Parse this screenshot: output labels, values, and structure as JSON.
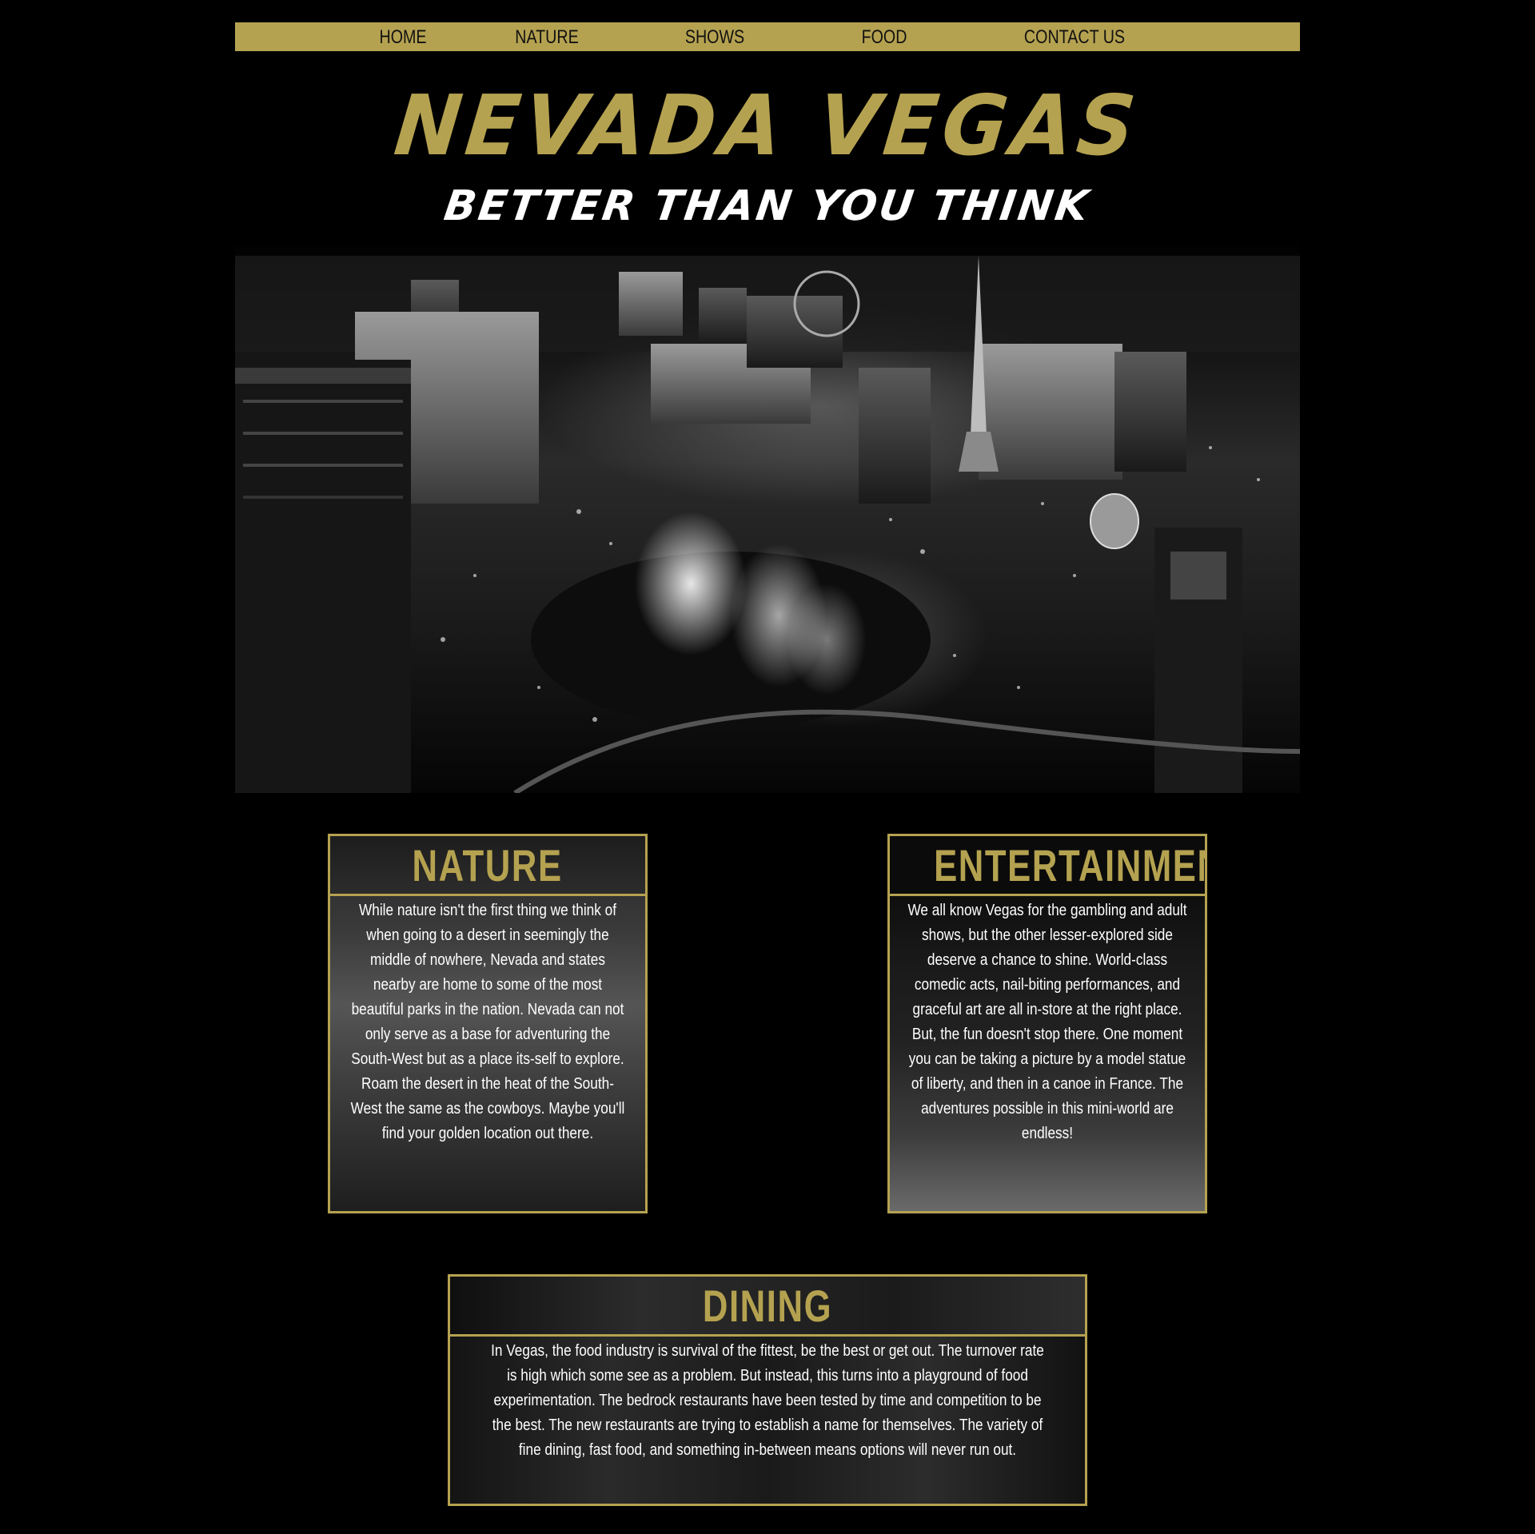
{
  "nav": {
    "items": [
      {
        "label": "HOME"
      },
      {
        "label": "NATURE"
      },
      {
        "label": "SHOWS"
      },
      {
        "label": "FOOD"
      },
      {
        "label": "CONTACT US"
      }
    ]
  },
  "header": {
    "title": "NEVADA VEGAS",
    "subtitle": "BETTER THAN YOU THINK"
  },
  "sections": {
    "nature": {
      "title": "NATURE",
      "text": "While nature isn't the first thing we think of when going to a desert in seemingly the middle of nowhere, Nevada and states nearby are home to some of the most beautiful parks in the nation. Nevada can not only serve as a base for adventuring the South-West but as a place its-self to explore. Roam the desert in the heat of the South-West the same as the cowboys. Maybe you'll find your golden location out there."
    },
    "entertainment": {
      "title": "ENTERTAINMENT",
      "text": "We all know Vegas for the gambling and adult shows, but the other lesser-explored side deserve a chance to shine. World-class comedic acts, nail-biting performances, and graceful art are all in-store at the right place. But, the fun doesn't stop there. One moment you can be taking a picture by a model statue of liberty, and then in a canoe in France. The adventures possible in this mini-world are endless!"
    },
    "dining": {
      "title": "DINING",
      "text": "In Vegas, the food industry is survival of the fittest, be the best or get out. The turnover rate is high which some see as a problem. But instead, this turns into a playground of food experimentation. The bedrock restaurants have been tested by time and competition to be the best. The new restaurants are trying to establish a name for themselves. The variety of fine dining, fast food, and something in-between means options will never run out."
    }
  },
  "colors": {
    "accent": "#b5a250",
    "background": "#000000",
    "text": "#ffffff"
  }
}
